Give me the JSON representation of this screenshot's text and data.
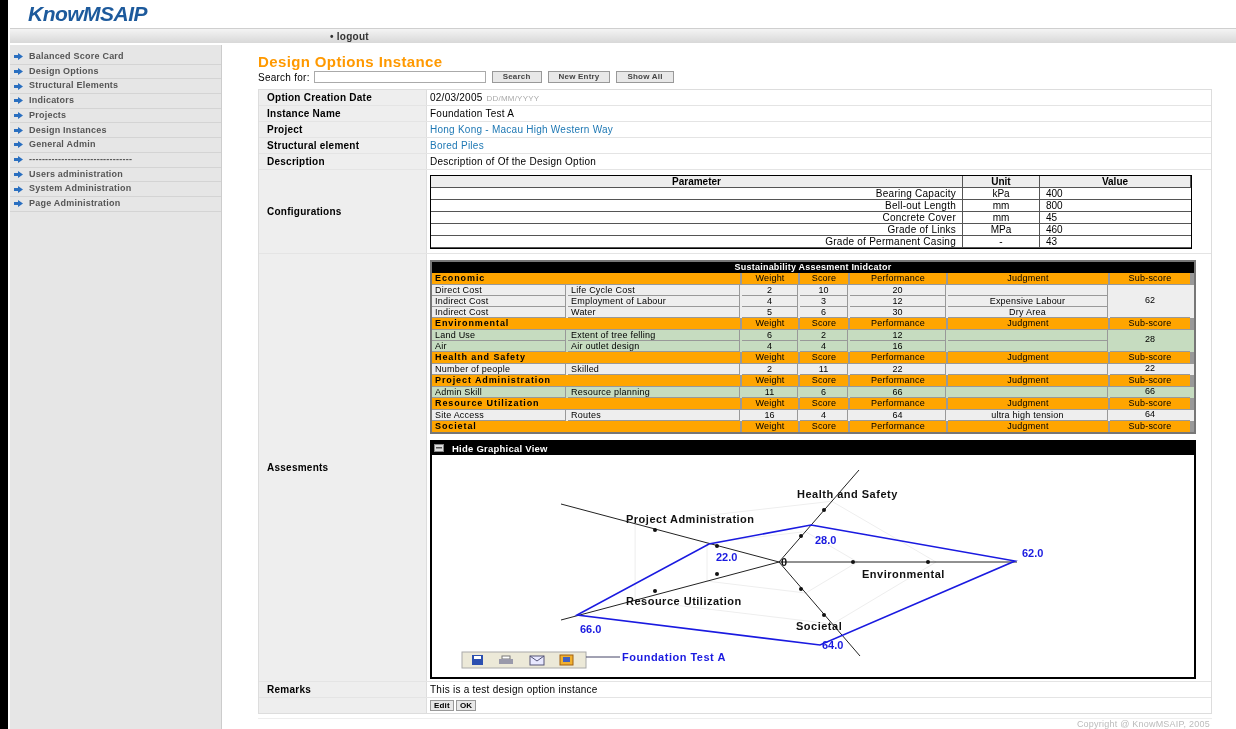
{
  "logo": "KnowMSAIP",
  "top_nav": [
    {
      "marker": "•",
      "label": "logout"
    }
  ],
  "sidebar": {
    "items": [
      {
        "label": "Balanced Score Card"
      },
      {
        "label": "Design Options"
      },
      {
        "label": "Structural Elements"
      },
      {
        "label": "Indicators"
      },
      {
        "label": "Projects"
      },
      {
        "label": "Design Instances"
      },
      {
        "label": "General Admin"
      },
      {
        "label": "--------------------------------"
      },
      {
        "label": "Users administration"
      },
      {
        "label": "System Administration"
      },
      {
        "label": "Page Administration"
      }
    ]
  },
  "page_title": "Design Options Instance",
  "search": {
    "label": "Search for:",
    "buttons": [
      "Search",
      "New Entry",
      "Show All"
    ]
  },
  "details": [
    {
      "label": "Option Creation Date",
      "value": "02/03/2005",
      "hint": "DD/MM/YYYY"
    },
    {
      "label": "Instance Name",
      "value": "Foundation Test A"
    },
    {
      "label": "Project",
      "value": "Hong Kong - Macau High Western Way",
      "kind": "link"
    },
    {
      "label": "Structural element",
      "value": "Bored Piles",
      "kind": "link"
    },
    {
      "label": "Description",
      "value": "Description of Of the Design Option"
    }
  ],
  "configurations": {
    "label": "Configurations",
    "columns": [
      "Parameter",
      "Unit",
      "Value"
    ],
    "rows": [
      {
        "parameter": "Bearing Capacity",
        "unit": "kPa",
        "value": "400"
      },
      {
        "parameter": "Bell-out Length",
        "unit": "mm",
        "value": "800"
      },
      {
        "parameter": "Concrete Cover",
        "unit": "mm",
        "value": "45"
      },
      {
        "parameter": "Grade of Links",
        "unit": "MPa",
        "value": "460"
      },
      {
        "parameter": "Grade of Permanent Casing",
        "unit": "-",
        "value": "43"
      }
    ]
  },
  "assessments": {
    "label": "Assesments",
    "title": "Sustainability Assesment Inidcator",
    "categories": [
      {
        "name": "Economic",
        "color": "#eeeeee",
        "columns": [
          "Weight",
          "Score",
          "Performance",
          "Judgment",
          "Sub-score"
        ],
        "sub_score": "62",
        "rows": [
          {
            "indicator": "Direct Cost",
            "criterion": "Life Cycle Cost",
            "weight": "2",
            "score": "10",
            "performance": "20"
          },
          {
            "indicator": "Indirect Cost",
            "criterion": "Employment of Labour",
            "weight": "4",
            "score": "3",
            "performance": "12",
            "judgment": "Expensive Labour"
          },
          {
            "indicator": "Indirect Cost",
            "criterion": "Water",
            "weight": "5",
            "score": "6",
            "performance": "30",
            "judgment": "Dry Area"
          }
        ]
      },
      {
        "name": "Environmental",
        "color": "#c6dcc0",
        "columns": [
          "Weight",
          "Score",
          "Performance",
          "Judgment",
          "Sub-score"
        ],
        "sub_score": "28",
        "rows": [
          {
            "indicator": "Land Use",
            "criterion": "Extent of tree felling",
            "weight": "6",
            "score": "2",
            "performance": "12"
          },
          {
            "indicator": "Air",
            "criterion": "Air outlet design",
            "weight": "4",
            "score": "4",
            "performance": "16"
          }
        ]
      },
      {
        "name": "Health and Safety",
        "color": "#eeeeee",
        "columns": [
          "Weight",
          "Score",
          "Performance",
          "Judgment",
          "Sub-score"
        ],
        "sub_score": "22",
        "rows": [
          {
            "indicator": "Number of people",
            "criterion": "Skilled",
            "weight": "2",
            "score": "11",
            "performance": "22"
          }
        ]
      },
      {
        "name": "Project Administration",
        "color": "#c6dcc0",
        "columns": [
          "Weight",
          "Score",
          "Performance",
          "Judgment",
          "Sub-score"
        ],
        "sub_score": "66",
        "rows": [
          {
            "indicator": "Admin Skill",
            "criterion": "Resource planning",
            "weight": "11",
            "score": "6",
            "performance": "66"
          }
        ]
      },
      {
        "name": "Resource Utilization",
        "color": "#eeeeee",
        "columns": [
          "Weight",
          "Score",
          "Performance",
          "Judgment",
          "Sub-score"
        ],
        "sub_score": "64",
        "rows": [
          {
            "indicator": "Site Access",
            "criterion": "Routes",
            "weight": "16",
            "score": "4",
            "performance": "64",
            "judgment": "ultra high tension"
          }
        ]
      },
      {
        "name": "Societal",
        "columns": [
          "Weight",
          "Score",
          "Performance",
          "Judgment",
          "Sub-score"
        ]
      }
    ],
    "graph": {
      "toggle_label": "Hide Graphical View",
      "origin_label": "0",
      "legend": "Foundation Test A",
      "axes": [
        {
          "label": "Health and Safety",
          "value_label": "28.0"
        },
        {
          "label": "Project Administration",
          "value_label": "22.0"
        },
        {
          "label": "Environmental",
          "value_label": "62.0"
        },
        {
          "label": "Resource Utilization",
          "value_label": "66.0"
        },
        {
          "label": "Societal",
          "value_label": "64.0"
        }
      ]
    }
  },
  "remarks": {
    "label": "Remarks",
    "value": "This is a test design option instance",
    "buttons": [
      "Edit",
      "OK"
    ]
  },
  "footer": "Copyright @ KnowMSAIP, 2005"
}
